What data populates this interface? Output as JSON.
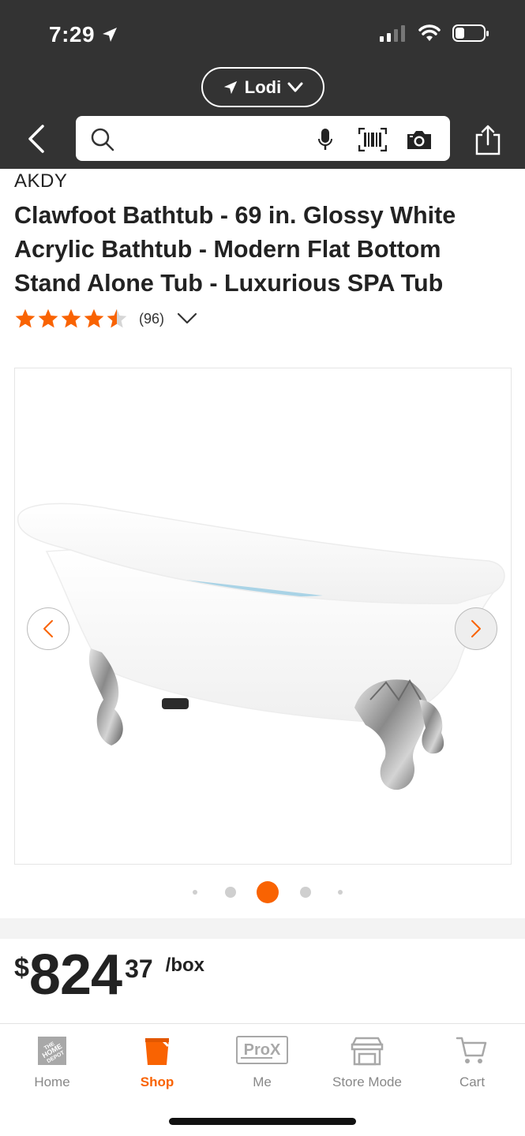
{
  "status_bar": {
    "time": "7:29"
  },
  "header": {
    "store_name": "Lodi",
    "search_placeholder": ""
  },
  "product": {
    "brand": "AKDY",
    "title": "Clawfoot Bathtub - 69 in. Glossy White Acrylic Bathtub - Modern Flat Bottom Stand Alone Tub - Luxurious SPA Tub",
    "rating_value": 4.5,
    "rating_max": 5,
    "review_count": "(96)",
    "image_carousel": {
      "total": 5,
      "active_index": 2
    },
    "price": {
      "currency": "$",
      "dollars": "824",
      "cents": "37",
      "unit": "/box"
    }
  },
  "tabbar": {
    "items": [
      {
        "label": "Home",
        "icon": "home-depot-logo-icon",
        "active": false
      },
      {
        "label": "Shop",
        "icon": "bucket-icon",
        "active": true
      },
      {
        "label": "Me",
        "icon": "prox-icon",
        "active": false,
        "badge": "ProX"
      },
      {
        "label": "Store Mode",
        "icon": "store-icon",
        "active": false
      },
      {
        "label": "Cart",
        "icon": "cart-icon",
        "active": false
      }
    ]
  },
  "colors": {
    "brand_orange": "#f96302",
    "header_bg": "#333333",
    "star": "#f96302"
  }
}
